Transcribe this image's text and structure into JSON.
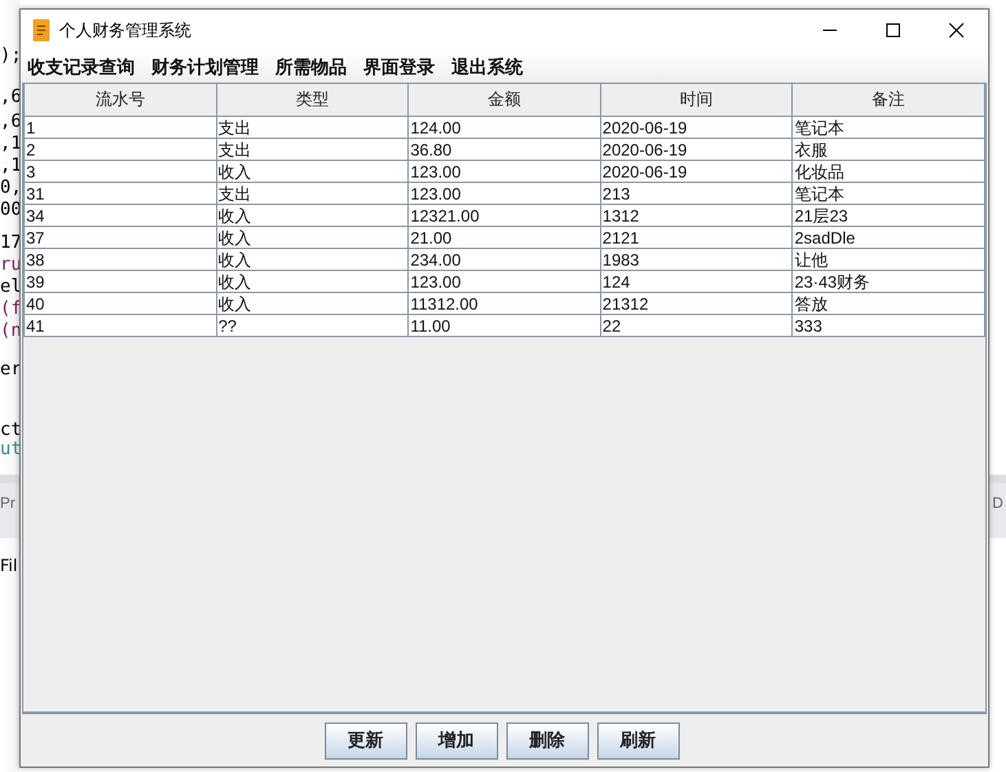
{
  "background": {
    "code_fragments": [
      ");",
      ",6",
      ",6",
      ",1",
      ",1",
      "0,",
      "00",
      "17",
      "ru",
      "el",
      "(f",
      "(n",
      "er",
      "ct",
      "ut"
    ],
    "panel_tab_left": "Pr",
    "panel_tab_right": "D",
    "file_label": "Fil"
  },
  "window": {
    "title": "个人财务管理系统"
  },
  "menu": [
    "收支记录查询",
    "财务计划管理",
    "所需物品",
    "界面登录",
    "退出系统"
  ],
  "table": {
    "columns": [
      "流水号",
      "类型",
      "金额",
      "时间",
      "备注"
    ],
    "rows": [
      [
        "1",
        "支出",
        "124.00",
        "2020-06-19",
        "笔记本"
      ],
      [
        "2",
        "支出",
        "36.80",
        "2020-06-19",
        "衣服"
      ],
      [
        "3",
        "收入",
        "123.00",
        "2020-06-19",
        "化妆品"
      ],
      [
        "31",
        "支出",
        "123.00",
        "213",
        "笔记本"
      ],
      [
        "34",
        "收入",
        "12321.00",
        "1312",
        "21层23"
      ],
      [
        "37",
        "收入",
        "21.00",
        "2121",
        "2sadDle"
      ],
      [
        "38",
        "收入",
        "234.00",
        "1983",
        "让他"
      ],
      [
        "39",
        "收入",
        "123.00",
        "124",
        "23·43财务"
      ],
      [
        "40",
        "收入",
        "11312.00",
        "21312",
        "答放"
      ],
      [
        "41",
        "??",
        "11.00",
        "22",
        "333"
      ]
    ]
  },
  "buttons": [
    "更新",
    "增加",
    "删除",
    "刷新"
  ]
}
